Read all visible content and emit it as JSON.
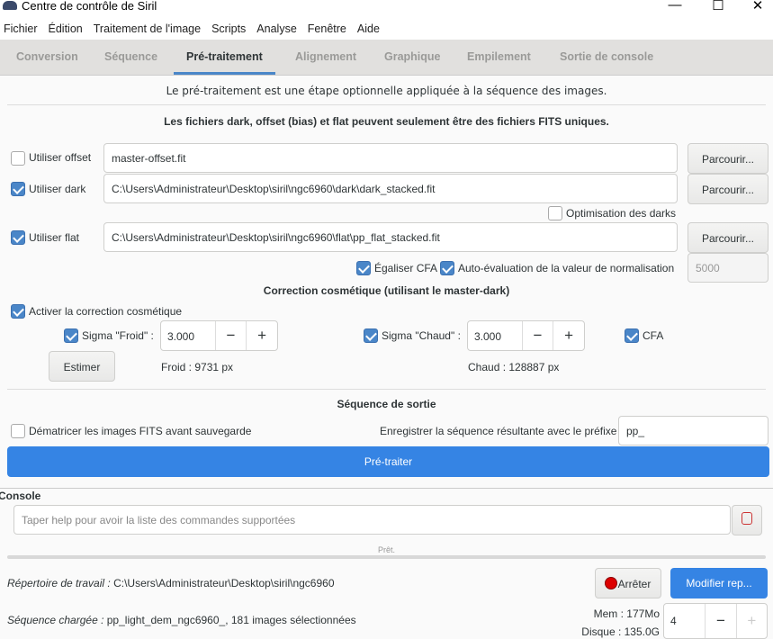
{
  "window": {
    "title": "Centre de contrôle de Siril",
    "minimize": "—",
    "maximize": "☐",
    "close": "✕"
  },
  "menu": [
    "Fichier",
    "Édition",
    "Traitement de l'image",
    "Scripts",
    "Analyse",
    "Fenêtre",
    "Aide"
  ],
  "tabs": [
    "Conversion",
    "Séquence",
    "Pré-traitement",
    "Alignement",
    "Graphique",
    "Empilement",
    "Sortie de console"
  ],
  "intro": "Le pré-traitement est une étape optionnelle appliquée à la séquence des images.",
  "note": "Les fichiers dark, offset (bias) et flat peuvent seulement être des fichiers FITS uniques.",
  "offset": {
    "label": "Utiliser offset",
    "checked": false,
    "path": "master-offset.fit",
    "browse": "Parcourir..."
  },
  "dark": {
    "label": "Utiliser dark",
    "checked": true,
    "path": "C:\\Users\\Administrateur\\Desktop\\siril\\ngc6960\\dark\\dark_stacked.fit",
    "browse": "Parcourir...",
    "optim": "Optimisation des darks"
  },
  "flat": {
    "label": "Utiliser flat",
    "checked": true,
    "path": "C:\\Users\\Administrateur\\Desktop\\siril\\ngc6960\\flat\\pp_flat_stacked.fit",
    "browse": "Parcourir...",
    "equalize": "Égaliser CFA",
    "auto_norm": "Auto-évaluation de la valeur de normalisation",
    "norm_value": "5000"
  },
  "cosmetic": {
    "title": "Correction cosmétique (utilisant le master-dark)",
    "enable": "Activer la correction cosmétique",
    "sigma_cold": "Sigma \"Froid\" :",
    "sigma_cold_value": "3.000",
    "sigma_hot": "Sigma \"Chaud\" :",
    "sigma_hot_value": "3.000",
    "cfa": "CFA",
    "estimate": "Estimer",
    "cold_count": "Froid : 9731 px",
    "hot_count": "Chaud : 128887 px",
    "minus": "−",
    "plus": "+"
  },
  "output": {
    "title": "Séquence de sortie",
    "debayer": "Dématricer les images FITS avant sauvegarde",
    "prefix_label": "Enregistrer la séquence résultante avec le préfixe :",
    "prefix": "pp_",
    "run": "Pré-traiter"
  },
  "console": {
    "label": "Console",
    "placeholder": "Taper help pour avoir la liste des commandes supportées",
    "status": "Prêt."
  },
  "footer": {
    "wd_label": "Répertoire de travail :",
    "wd": " C:\\Users\\Administrateur\\Desktop\\siril\\ngc6960",
    "seq_label": "Séquence chargée :",
    "seq": " pp_light_dem_ngc6960_, 181 images sélectionnées",
    "stop": "Arrêter",
    "change_dir": "Modifier rep...",
    "mem": "Mem : 177Mo",
    "disk": "Disque : 135.0G",
    "threads": "4"
  }
}
